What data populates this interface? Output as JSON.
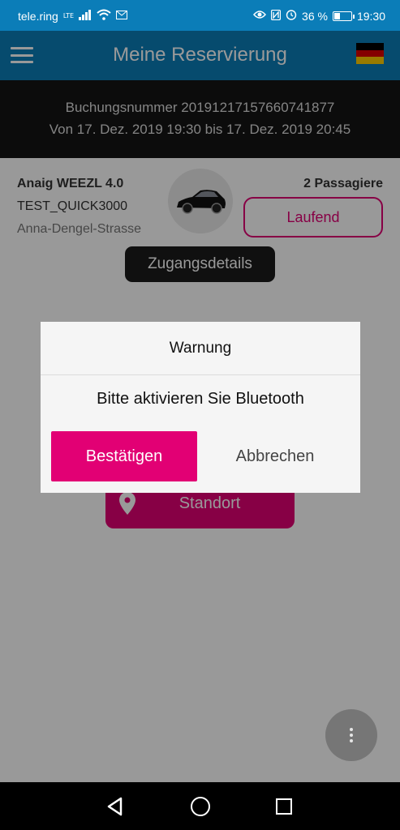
{
  "status_bar": {
    "carrier": "tele.ring",
    "network_type": "LTE",
    "battery_level_percent": 36,
    "battery_text": "36 %",
    "time": "19:30"
  },
  "app_bar": {
    "title": "Meine Reservierung",
    "menu_icon": "hamburger-menu-icon",
    "language_flag": "germany-flag-icon",
    "color": "#0b7db8"
  },
  "booking": {
    "number_line": "Buchungsnummer 20191217157660741877",
    "period_line": "Von 17. Dez. 2019 19:30 bis 17. Dez. 2019 20:45"
  },
  "vehicle": {
    "name": "Anaig WEEZL 4.0",
    "id": "TEST_QUICK3000",
    "address": "Anna-Dengel-Strasse",
    "passengers": "2 Passagiere",
    "status": "Laufend",
    "image_icon": "car-icon"
  },
  "access_tab": {
    "label": "Zugangsdetails"
  },
  "actions": {
    "location_label": "Standort",
    "location_icon": "map-pin-icon"
  },
  "dialog": {
    "title": "Warnung",
    "message": "Bitte aktivieren Sie Bluetooth",
    "confirm_label": "Bestätigen",
    "cancel_label": "Abbrechen"
  },
  "colors": {
    "accent": "#e20074",
    "primary": "#0b7db8"
  }
}
